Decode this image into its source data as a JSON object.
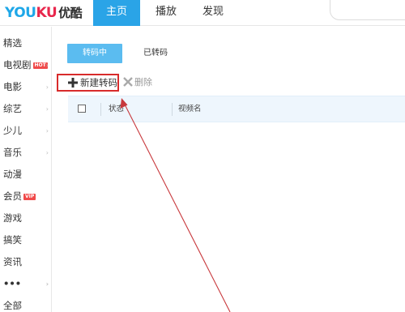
{
  "header": {
    "logo_you": "YOU",
    "logo_ku": "KU",
    "logo_cn": "优酷",
    "nav": [
      {
        "label": "主页"
      },
      {
        "label": "播放"
      },
      {
        "label": "发现"
      }
    ]
  },
  "sidebar": {
    "items": [
      {
        "label": "精选"
      },
      {
        "label": "电视剧",
        "badge": "HOT"
      },
      {
        "label": "电影"
      },
      {
        "label": "综艺"
      },
      {
        "label": "少儿"
      },
      {
        "label": "音乐"
      },
      {
        "label": "动漫"
      },
      {
        "label": "会员",
        "badge": "VIP"
      },
      {
        "label": "游戏"
      },
      {
        "label": "搞笑"
      },
      {
        "label": "资讯"
      },
      {
        "label": "•••"
      },
      {
        "label": "全部"
      }
    ]
  },
  "main": {
    "tabs": [
      {
        "label": "转码中"
      },
      {
        "label": "已转码"
      }
    ],
    "toolbar": {
      "new_label": "新建转码",
      "delete_label": "删除"
    },
    "table": {
      "columns": [
        "状态",
        "视频名"
      ]
    }
  },
  "colors": {
    "accent": "#2aa4e7",
    "tab_active": "#5bbcf0",
    "highlight_box": "#d82b2b",
    "annotation_arrow": "#c8383c"
  }
}
